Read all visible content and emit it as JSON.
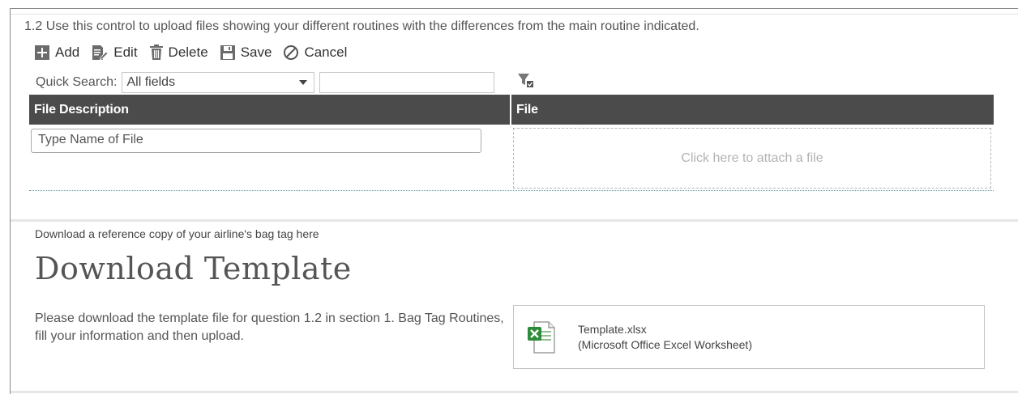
{
  "question": {
    "text": "1.2  Use this control to upload files showing your different routines with the differences from the main routine indicated."
  },
  "toolbar": {
    "add_label": "Add",
    "edit_label": "Edit",
    "delete_label": "Delete",
    "save_label": "Save",
    "cancel_label": "Cancel"
  },
  "quick_search": {
    "label": "Quick Search:",
    "field_selected": "All fields",
    "query_value": ""
  },
  "grid": {
    "columns": [
      "File Description",
      "File"
    ],
    "row": {
      "description_placeholder": "Type Name of File",
      "attach_text": "Click here to attach a file"
    }
  },
  "download": {
    "note": "Download a reference copy of your airline's bag tag here",
    "title": "Download Template",
    "instructions": "Please download the template file for question 1.2 in section 1. Bag Tag Routines, fill your information and then upload.",
    "file_name": "Template.xlsx",
    "file_type": "(Microsoft Office Excel Worksheet)",
    "file_icon": "excel-file-icon"
  },
  "colors": {
    "header_bg": "#4b4b4b",
    "excel_green": "#2e8b3a"
  }
}
